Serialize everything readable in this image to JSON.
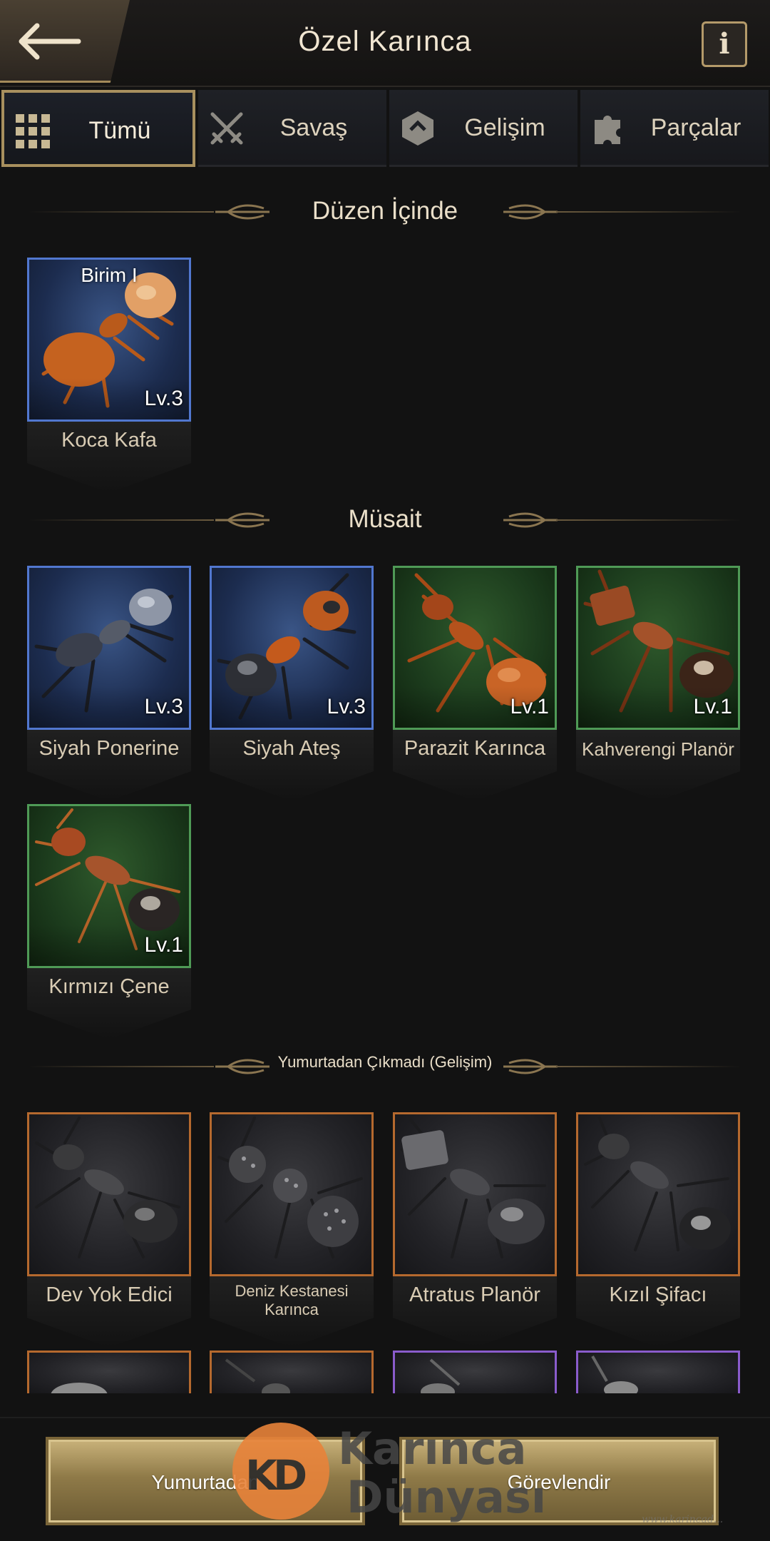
{
  "header": {
    "title": "Özel Karınca",
    "info_label": "i"
  },
  "tabs": [
    {
      "label": "Tümü",
      "icon": "grid-icon",
      "active": true
    },
    {
      "label": "Savaş",
      "icon": "crossed-swords-icon",
      "active": false
    },
    {
      "label": "Gelişim",
      "icon": "hexagon-arrow-icon",
      "active": false
    },
    {
      "label": "Parçalar",
      "icon": "puzzle-piece-icon",
      "active": false
    }
  ],
  "sections": {
    "in_formation": {
      "title": "Düzen İçinde",
      "cards": [
        {
          "name": "Koca Kafa",
          "level": "Lv.3",
          "unit": "Birim I",
          "rarity": "blue"
        }
      ]
    },
    "available": {
      "title": "Müsait",
      "cards": [
        {
          "name": "Siyah Ponerine",
          "level": "Lv.3",
          "rarity": "blue"
        },
        {
          "name": "Siyah Ateş",
          "level": "Lv.3",
          "rarity": "blue"
        },
        {
          "name": "Parazit Karınca",
          "level": "Lv.1",
          "rarity": "green"
        },
        {
          "name": "Kahverengi Planör",
          "level": "Lv.1",
          "rarity": "green"
        },
        {
          "name": "Kırmızı Çene",
          "level": "Lv.1",
          "rarity": "green"
        }
      ]
    },
    "unhatched": {
      "title": "Yumurtadan Çıkmadı (Gelişim)",
      "cards": [
        {
          "name": "Dev Yok Edici",
          "rarity": "orange"
        },
        {
          "name": "Deniz Kestanesi Karınca",
          "rarity": "orange"
        },
        {
          "name": "Atratus Planör",
          "rarity": "orange"
        },
        {
          "name": "Kızıl Şifacı",
          "rarity": "orange"
        }
      ]
    }
  },
  "bottom": {
    "hatch_label": "Yumurtadan",
    "assign_label": "Görevlendir"
  },
  "watermark": {
    "logo": "KD",
    "line1": "Karınca",
    "line2": "Dünyası",
    "url": "www.karincad..."
  },
  "colors": {
    "gold": "#a8905e",
    "blue_rarity": "#5177cf",
    "green_rarity": "#4f9a56",
    "orange_rarity": "#b5692e",
    "purple_rarity": "#8a5ccc"
  }
}
